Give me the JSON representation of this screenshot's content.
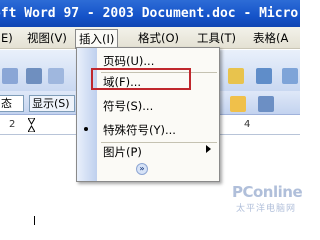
{
  "window": {
    "title": "oft Word 97 - 2003 Document.doc - Micro"
  },
  "menubar": {
    "items": [
      {
        "label": "E)"
      },
      {
        "label": "视图(V)"
      },
      {
        "label": "插入(I)"
      },
      {
        "label": "格式(O)"
      },
      {
        "label": "工具(T)"
      },
      {
        "label": "表格(A"
      }
    ]
  },
  "insert_menu": {
    "items": [
      {
        "label": "页码(U)..."
      },
      {
        "label": "域(F)..."
      },
      {
        "label": "符号(S)..."
      },
      {
        "label": "特殊符号(Y)..."
      },
      {
        "label": "图片(P)"
      }
    ],
    "expand_glyph": "»"
  },
  "toolbar": {
    "style_select": "态",
    "display_select": "显示(S)"
  },
  "ruler": {
    "numbers": [
      "2",
      "4"
    ]
  },
  "watermark": {
    "logo": "PConline",
    "subtitle": "太平洋电脑网"
  }
}
